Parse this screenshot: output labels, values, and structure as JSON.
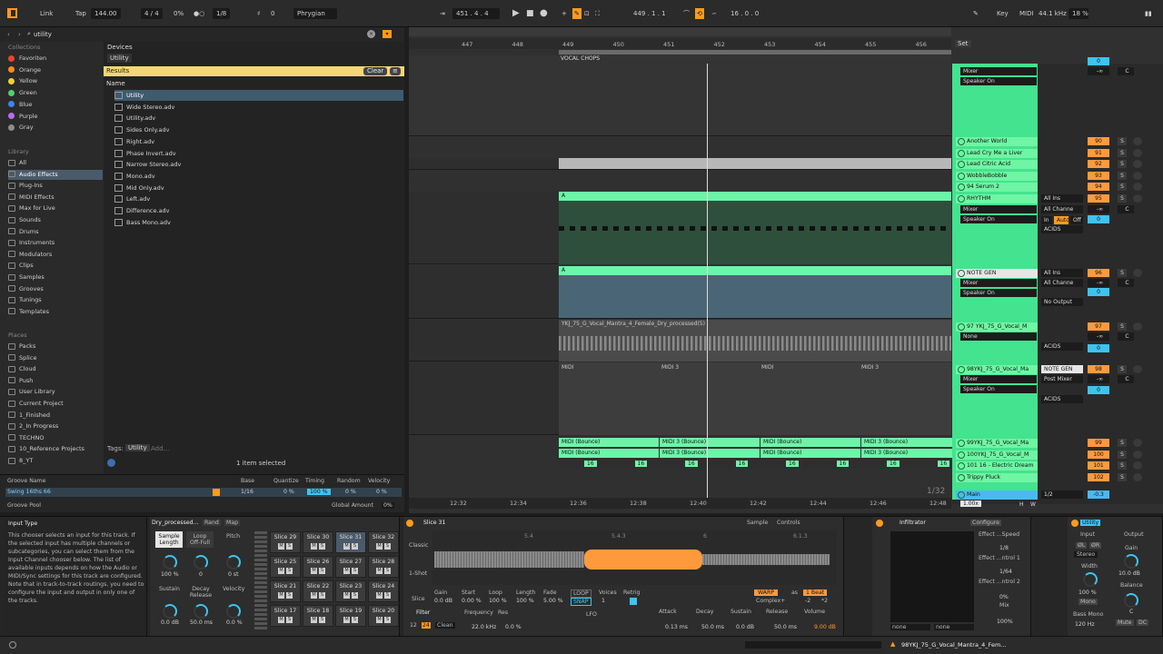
{
  "topbar": {
    "link": "Link",
    "tap": "Tap",
    "tempo": "144.00",
    "sig": "4 / 4",
    "pct": "0%",
    "quant": "1/8",
    "zero": "0",
    "scale": "Phrygian",
    "pos1": "451 .  4 .  4",
    "pos2": "449 .  1 .  1",
    "pos3": "16 .  0 .  0",
    "key": "Key",
    "midi": "MIDI",
    "rate": "44.1 kHz",
    "cpu": "18 %"
  },
  "browser": {
    "search": "utility",
    "collections_h": "Collections",
    "collections": [
      {
        "label": "Favoriten",
        "color": "#e8462f"
      },
      {
        "label": "Orange",
        "color": "#ff8a1f"
      },
      {
        "label": "Yellow",
        "color": "#f2d22a"
      },
      {
        "label": "Green",
        "color": "#4ed16a"
      },
      {
        "label": "Blue",
        "color": "#3f84f0"
      },
      {
        "label": "Purple",
        "color": "#b56cf0"
      },
      {
        "label": "Gray",
        "color": "#8d8d8d"
      }
    ],
    "library_h": "Library",
    "library": [
      "All",
      "Audio Effects",
      "Plug-Ins",
      "MIDI Effects",
      "Max for Live",
      "Sounds",
      "Drums",
      "Instruments",
      "Modulators",
      "Clips",
      "Samples",
      "Grooves",
      "Tunings",
      "Templates"
    ],
    "places_h": "Places",
    "places": [
      "Packs",
      "Splice",
      "Cloud",
      "Push",
      "User Library",
      "Current Project",
      "1_Finished",
      "2_In Progress",
      "TECHNO",
      "10_Reference Projects",
      "8_YT"
    ],
    "devices_tab": "Devices",
    "utility_chip": "Utility",
    "results": "Results",
    "clear": "Clear",
    "name_col": "Name",
    "files": [
      "Utility",
      "Wide Stereo.adv",
      "Utility.adv",
      "Sides Only.adv",
      "Right.adv",
      "Phase Invert.adv",
      "Narrow Stereo.adv",
      "Mono.adv",
      "Mid Only.adv",
      "Left.adv",
      "Difference.adv",
      "Bass Mono.adv"
    ],
    "tags": "Tags:",
    "tag": "Utility",
    "add": "Add...",
    "selected": "1 item selected"
  },
  "groove": {
    "h_name": "Groove Name",
    "h_base": "Base",
    "h_quant": "Quantize",
    "h_timing": "Timing",
    "h_random": "Random",
    "h_vel": "Velocity",
    "name": "Swing 16ths 66",
    "base": "1/16",
    "quant": "0 %",
    "timing": "100 %",
    "random": "0 %",
    "vel": "0 %",
    "pool": "Groove Pool",
    "global": "Global Amount",
    "global_val": "0%"
  },
  "ruler": {
    "bars": [
      "447",
      "448",
      "449",
      "450",
      "451",
      "452",
      "453",
      "454",
      "455",
      "456"
    ],
    "times": [
      "12:32",
      "12:34",
      "12:36",
      "12:38",
      "12:40",
      "12:42",
      "12:44",
      "12:46",
      "12:48"
    ],
    "set": "Set",
    "zoom": "1/32"
  },
  "clips": {
    "vocal_chops": "VOCAL CHOPS",
    "a1": "A",
    "a2": "A",
    "yk": "YKJ_75_G_Vocal_Mantra_4_Female_Dry_processed(5)",
    "midi": [
      "MIDI",
      "MIDI 3",
      "MIDI",
      "MIDI 3"
    ],
    "bounce": [
      "MIDI (Bounce)",
      "MIDI 3 (Bounce)",
      "MIDI (Bounce)",
      "MIDI 3 (Bounce)"
    ],
    "sixteen": "16"
  },
  "mixer": {
    "mixer": "Mixer",
    "speaker": "Speaker On",
    "tracks": [
      "Another World",
      "Lead Cry Me a Liver",
      "Lead Citric Acid",
      "WobbleBobble",
      "94 Serum 2",
      "RHYTHM",
      "NOTE GEN",
      "97 YKJ_75_G_Vocal_M",
      "98YKJ_75_G_Vocal_Ma",
      "99YKJ_75_G_Vocal_Ma",
      "100YKJ_75_G_Vocal_M",
      "101 16 - Electric Dream",
      "Trippy Pluck",
      "Main"
    ],
    "nums": [
      "90",
      "91",
      "92",
      "93",
      "94",
      "95",
      "96",
      "97",
      "98",
      "99",
      "100",
      "101",
      "102"
    ],
    "allins": "All Ins",
    "allchan": "All Channe",
    "in": "In",
    "auto": "Auto",
    "off": "Off",
    "acids": "ACIDS",
    "none": "None",
    "noout": "No Output",
    "notegen": "NOTE GEN",
    "postmixer": "Post Mixer",
    "one": "1",
    "ninf": "-∞",
    "zero": "0",
    "c": "C",
    "s": "S",
    "half": "1/2",
    "main_val": "-0.3",
    "main_z": "0",
    "main_x": "1.00x",
    "h": "H",
    "w": "W"
  },
  "info": {
    "title": "Input Type",
    "text": "This chooser selects an input for this track. If the selected input has multiple channels or subcategories, you can select them from the Input Channel chooser below. The list of available inputs depends on how the Audio or MIDI/Sync settings for this track are configured. Note that in track-to-track routings, you need to configure the input and output in only one of the tracks."
  },
  "drum": {
    "name": "Dry_processed...",
    "rand": "Rand",
    "map": "Map",
    "sample_len": "Sample Length",
    "loop": "Loop Off-Full",
    "pitch": "Pitch",
    "v1": "100 %",
    "v2": "0",
    "v3": "0 st",
    "sustain": "Sustain",
    "decay": "Decay Release",
    "velocity": "Velocity",
    "v4": "0.0 dB",
    "v5": "50.0 ms",
    "v6": "0.0 %",
    "slices": [
      "Slice 29",
      "Slice 30",
      "Slice 31",
      "Slice 32",
      "Slice 25",
      "Slice 26",
      "Slice 27",
      "Slice 28",
      "Slice 21",
      "Slice 22",
      "Slice 23",
      "Slice 24",
      "Slice 17",
      "Slice 18",
      "Slice 19",
      "Slice 20"
    ],
    "m": "M",
    "s": "S"
  },
  "simpler": {
    "title": "Slice 31",
    "sample": "Sample",
    "controls": "Controls",
    "classic": "Classic",
    "oneshot": "1-Shot",
    "slice": "Slice",
    "gain": "Gain",
    "gain_v": "0.0 dB",
    "start": "Start",
    "start_v": "0.00 %",
    "loopl": "Loop",
    "loop_v": "100 %",
    "length": "Length",
    "length_v": "100 %",
    "fade": "Fade",
    "fade_v": "5.00 %",
    "loopbtn": "LOOP",
    "snap": "SNAP",
    "voices": "Voices",
    "voices_v": "1",
    "retrig": "Retrig",
    "warp": "WARP",
    "as": "as",
    "beat": "1 Beat",
    "complex": "Complex+",
    "m2": "-2",
    "x2": "*2",
    "m54": "5.4",
    "m543": "5.4.3",
    "m6": "6",
    "m613": "6.1.3",
    "filter": "Filter",
    "freq": "Frequency",
    "freq_v": "22.0 kHz",
    "res": "Res",
    "res_v": "0.0 %",
    "n12": "12",
    "n24": "24",
    "clean": "Clean",
    "lfo": "LFO",
    "attack": "Attack",
    "attack_v": "0.13 ms",
    "decay": "Decay",
    "decay_v": "50.0 ms",
    "sus": "Sustain",
    "sus_v": "0.0 dB",
    "release": "Release",
    "release_v": "50.0 ms",
    "volume": "Volume",
    "volume_v": "9.00 dB"
  },
  "infiltrator": {
    "title": "Infiltrator",
    "configure": "Configure",
    "speed": "Effect ...Speed",
    "v1": "1/8",
    "ctrl1": "Effect ...ntrol 1",
    "v2": "1/64",
    "ctrl2": "Effect ...ntrol 2",
    "v3": "0%",
    "mix": "Mix",
    "v4": "100%",
    "none1": "none",
    "none2": "none"
  },
  "utility": {
    "title": "Utility",
    "input": "Input",
    "output": "Output",
    "gain": "Gain",
    "gain_v": "10.0 dB",
    "l": "ØL",
    "r": "ØR",
    "stereo": "Stereo",
    "width": "Width",
    "width_v": "100 %",
    "balance": "Balance",
    "balance_v": "C",
    "mono": "Mono",
    "bassmono": "Bass Mono",
    "hz": "120 Hz",
    "mute": "Mute",
    "dc": "DC"
  },
  "status": {
    "track": "98YKJ_75_G_Vocal_Mantra_4_Fem..."
  }
}
